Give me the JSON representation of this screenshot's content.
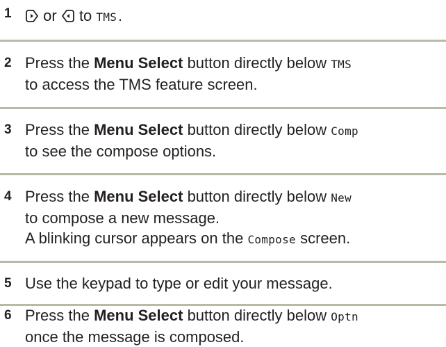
{
  "steps": [
    {
      "number": "1",
      "or_text": "or",
      "to_text": "to",
      "lcd_target": "TMS."
    },
    {
      "number": "2",
      "press": "Press the",
      "button_name": "Menu Select",
      "directly_below": "button directly below",
      "lcd_target": "TMS",
      "line2": "to access the TMS feature screen."
    },
    {
      "number": "3",
      "press": "Press the",
      "button_name": "Menu Select",
      "directly_below": "button directly below",
      "lcd_target": "Comp",
      "line2": "to see the compose options."
    },
    {
      "number": "4",
      "press": "Press the",
      "button_name": "Menu Select",
      "directly_below": "button directly below",
      "lcd_target": "New",
      "line2": "to compose a new message.",
      "line3_before": "A blinking cursor appears on the",
      "line3_lcd": "Compose",
      "line3_after": "screen."
    },
    {
      "number": "5",
      "text": "Use the keypad to type or edit your message."
    },
    {
      "number": "6",
      "press": "Press the",
      "button_name": "Menu Select",
      "directly_below": "button directly below",
      "lcd_target": "Optn",
      "line2": "once the message is composed."
    }
  ],
  "icons": {
    "left": "nav-left-icon",
    "right": "nav-right-icon"
  },
  "colors": {
    "text": "#231f20",
    "divider": "#b9b9a6"
  }
}
